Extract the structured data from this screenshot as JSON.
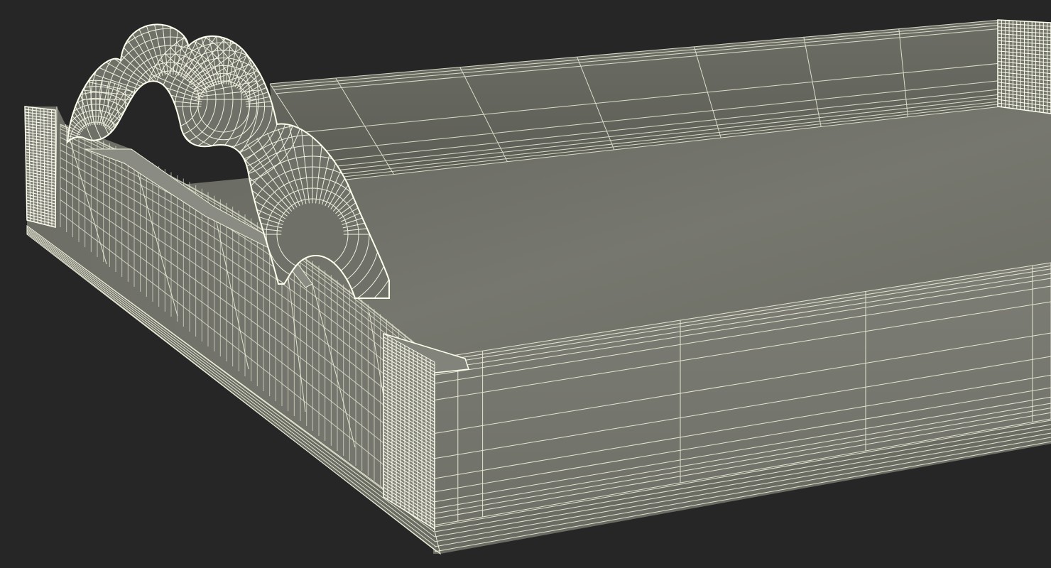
{
  "scene": {
    "subject": "wireframe-tray-render",
    "colors": {
      "background": "#262626",
      "tray_fill": "#75766d",
      "tray_floor": "#6e6f66",
      "tray_shade": "#5d5e56",
      "tray_dark": "#4f5049",
      "wire": "#f1f1dd",
      "wire_dense": "#ffffee"
    },
    "labels": []
  }
}
